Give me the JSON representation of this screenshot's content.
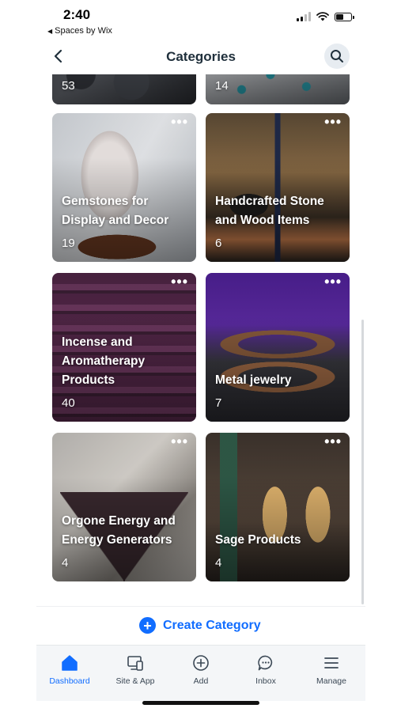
{
  "status_bar": {
    "time": "2:40",
    "back_app": "Spaces by Wix"
  },
  "header": {
    "title": "Categories"
  },
  "categories": [
    {
      "name": "",
      "count": "53"
    },
    {
      "name": "",
      "count": "14"
    },
    {
      "name": "Gemstones for Display and Decor",
      "count": "19"
    },
    {
      "name": "Handcrafted Stone and Wood Items",
      "count": "6"
    },
    {
      "name": "Incense and Aromatherapy Products",
      "count": "40"
    },
    {
      "name": "Metal jewelry",
      "count": "7"
    },
    {
      "name": "Orgone Energy and Energy Generators",
      "count": "4"
    },
    {
      "name": "Sage Products",
      "count": "4"
    }
  ],
  "more_label": "•••",
  "create": {
    "label": "Create Category"
  },
  "tabs": [
    {
      "label": "Dashboard",
      "icon": "home-icon",
      "active": true
    },
    {
      "label": "Site & App",
      "icon": "devices-icon"
    },
    {
      "label": "Add",
      "icon": "add-circle-icon"
    },
    {
      "label": "Inbox",
      "icon": "chat-icon"
    },
    {
      "label": "Manage",
      "icon": "menu-icon"
    }
  ],
  "colors": {
    "accent": "#116dff",
    "title": "#20303c",
    "tabbar_bg": "#f4f6f8"
  }
}
